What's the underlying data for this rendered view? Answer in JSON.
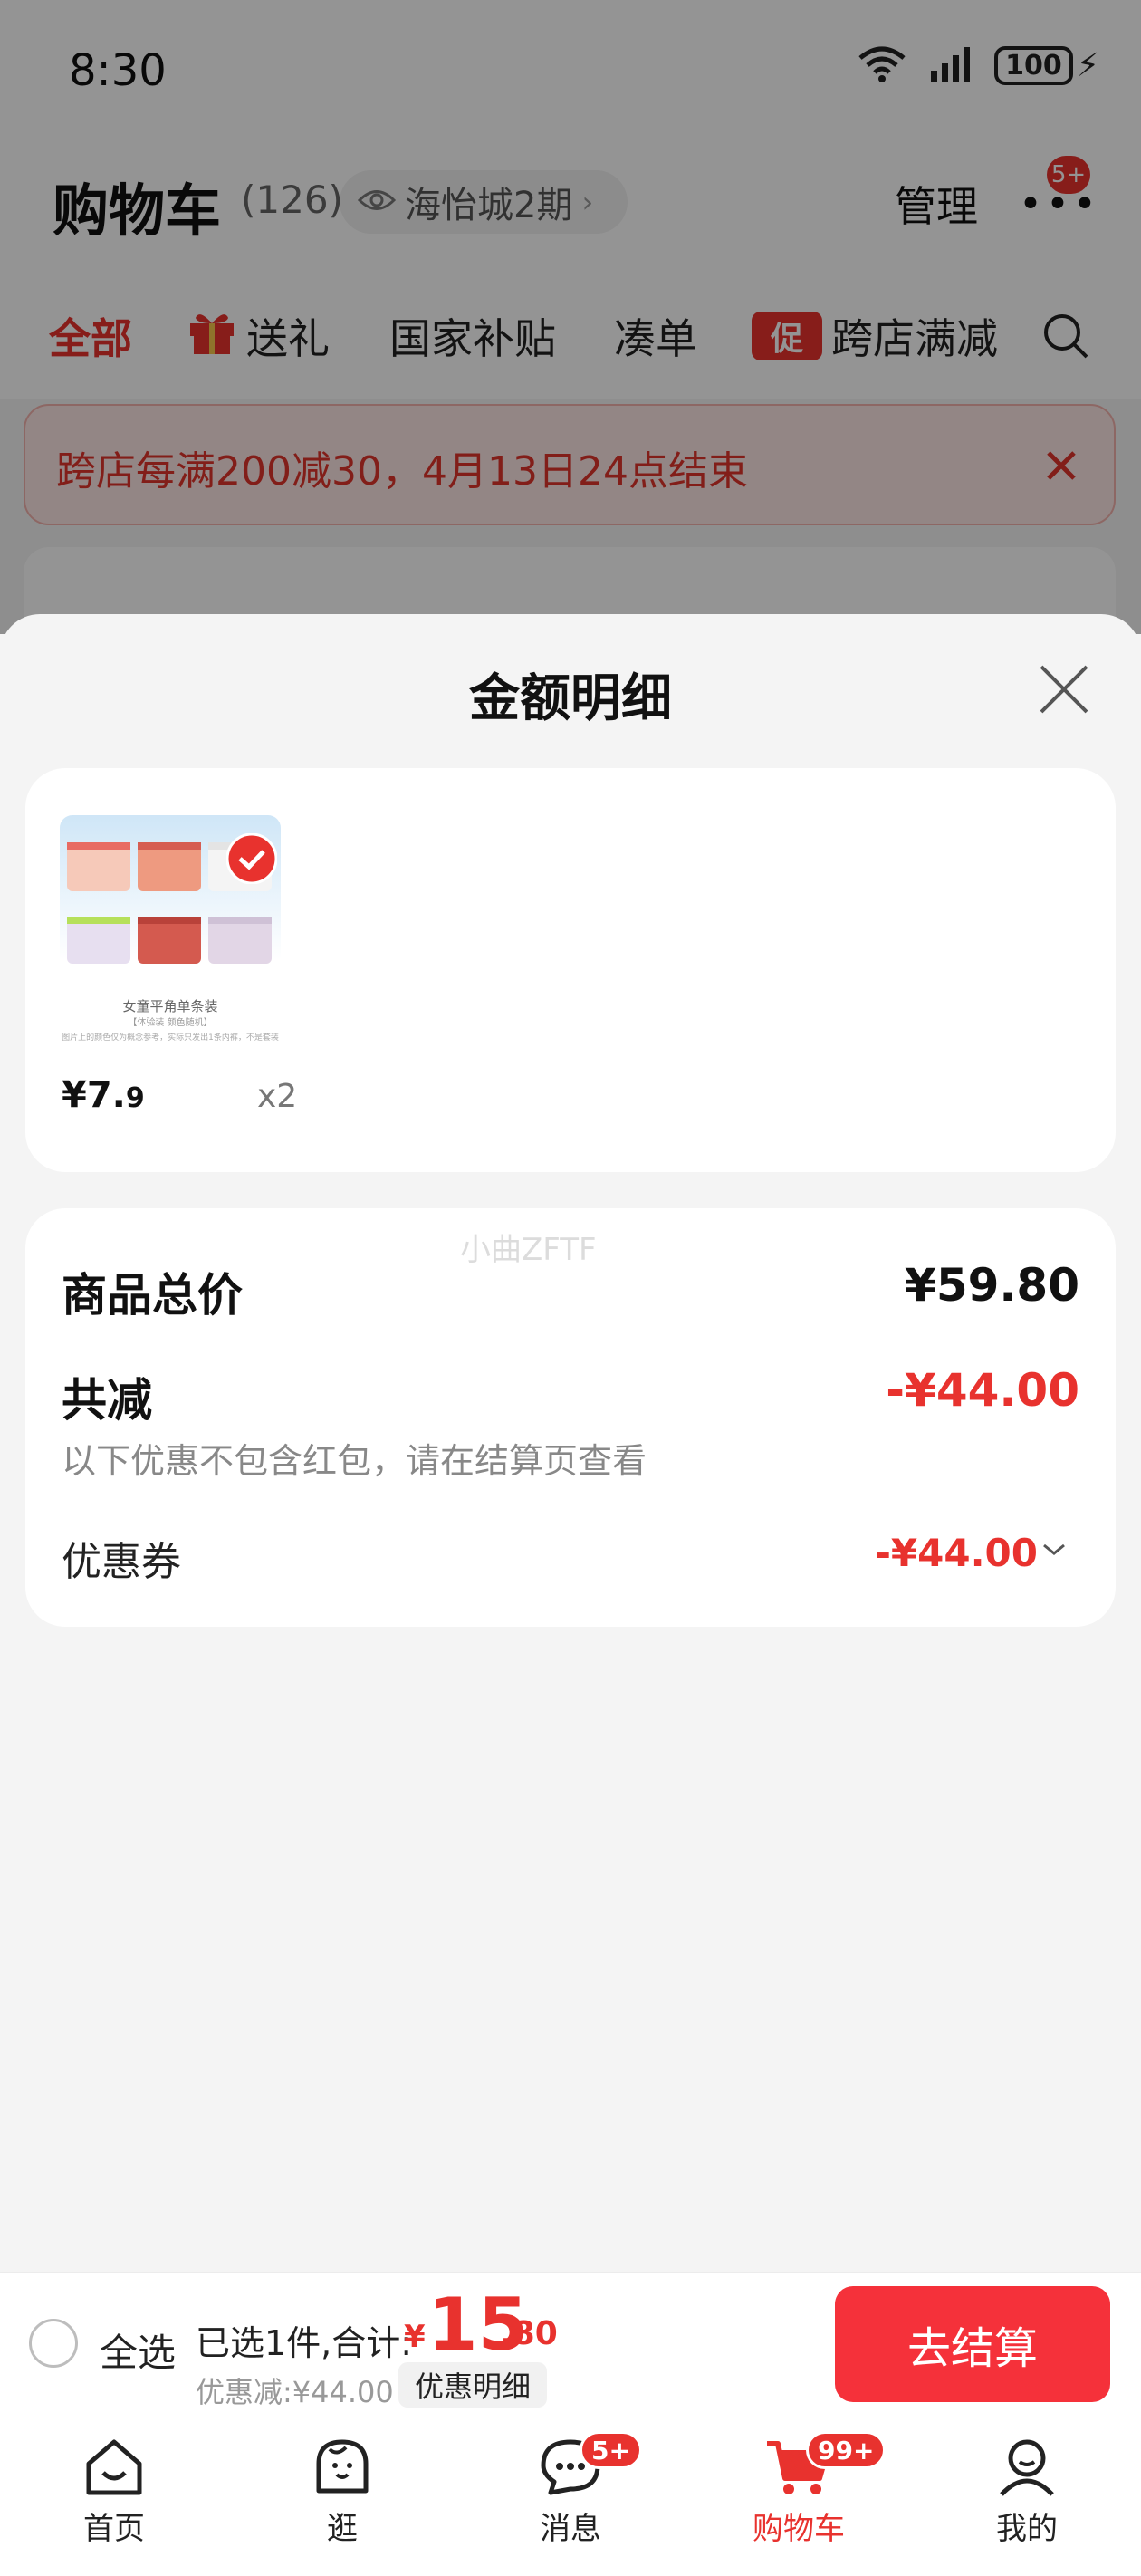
{
  "status_bar": {
    "time": "8:30",
    "network_label": "6",
    "battery": "100"
  },
  "header": {
    "title": "购物车",
    "count": "(126)",
    "location": "海怡城2期",
    "manage_label": "管理",
    "more_badge": "5+"
  },
  "tabs": [
    {
      "label": "全部"
    },
    {
      "label": "送礼"
    },
    {
      "label": "国家补贴"
    },
    {
      "label": "凑单"
    },
    {
      "label": "跨店满减",
      "tag": "促"
    }
  ],
  "promo_banner": {
    "text": "跨店每满200减30，4月13日24点结束"
  },
  "sheet": {
    "title": "金额明细",
    "product": {
      "image_caption": "女童平角单条装",
      "image_subcaption": "【体验装 颜色随机】",
      "image_note": "图片上的颜色仅为概念参考，实际只发出1条内裤，不是套装",
      "price_main": "¥7.",
      "price_decimal": "9",
      "quantity": "x2"
    },
    "watermark": "小曲ZFTF",
    "total_label": "商品总价",
    "total_value": "¥59.80",
    "reduce_label": "共减",
    "reduce_value": "-¥44.00",
    "reduce_note": "以下优惠不包含红包，请在结算页查看",
    "coupon_label": "优惠券",
    "coupon_value": "-¥44.00"
  },
  "checkout": {
    "select_all": "全选",
    "selected_text": "已选1件,合计:",
    "currency": "¥",
    "sum_integer": "15",
    "sum_decimal": ".80",
    "discount_text": "优惠减:¥44.00",
    "detail_chip": "优惠明细",
    "button": "去结算"
  },
  "bottom_nav": [
    {
      "label": "首页"
    },
    {
      "label": "逛"
    },
    {
      "label": "消息",
      "badge": "5+"
    },
    {
      "label": "购物车",
      "badge": "99+"
    },
    {
      "label": "我的"
    }
  ],
  "colors": {
    "accent": "#e8322e",
    "checkout_button": "#f5313a",
    "sheet_bg": "#f4f4f4"
  }
}
